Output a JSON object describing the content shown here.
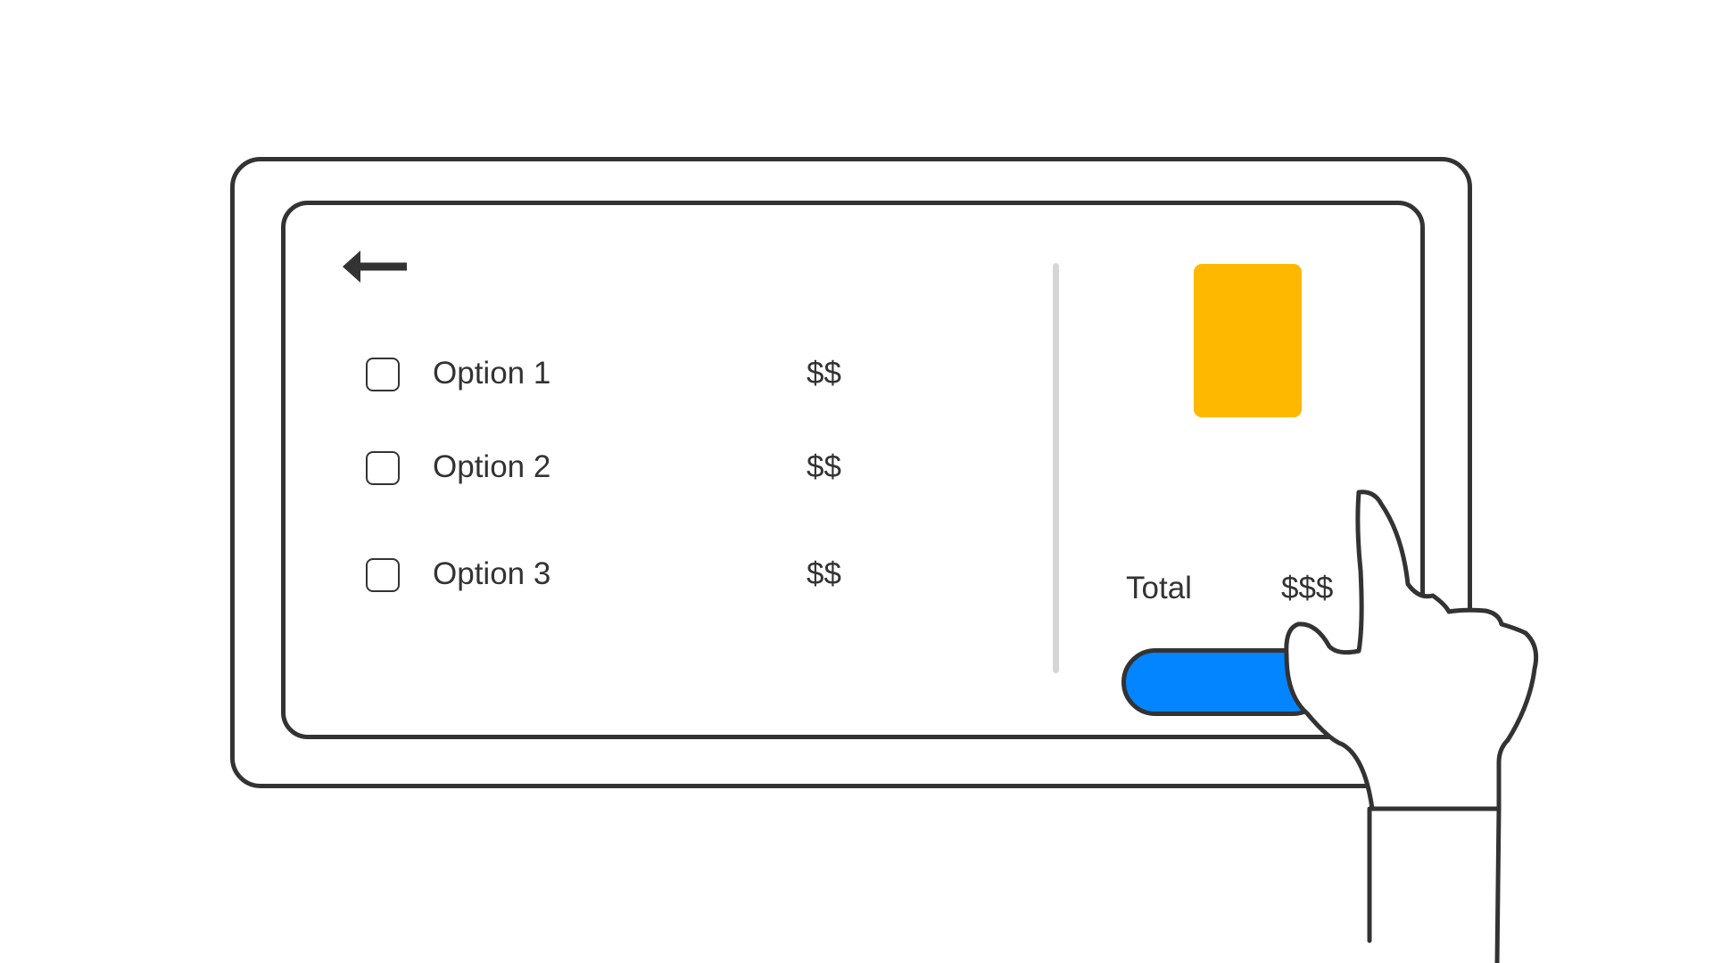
{
  "options": [
    {
      "label": "Option 1",
      "price": "$$",
      "checked": false
    },
    {
      "label": "Option 2",
      "price": "$$",
      "checked": false
    },
    {
      "label": "Option 3",
      "price": "$$",
      "checked": false
    }
  ],
  "summary": {
    "total_label": "Total",
    "total_value": "$$$"
  },
  "icons": {
    "back": "arrow-left-icon",
    "hand": "pointing-hand-icon"
  },
  "colors": {
    "outline": "#333333",
    "product_card": "#FFB800",
    "checkout_button": "#0385FF",
    "divider": "#D6D6D6"
  }
}
